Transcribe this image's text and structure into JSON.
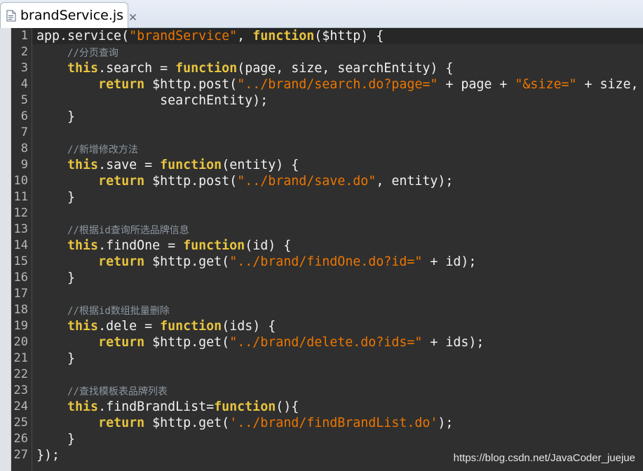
{
  "tab": {
    "title": "brandService.js",
    "icon": "js-file-icon"
  },
  "colors": {
    "background": "#2f2f2f",
    "keyword": "#e8c540",
    "string": "#ec7600",
    "comment": "#8c97a1",
    "text": "#f1f2f3",
    "line_number": "#b8b8b8"
  },
  "editor": {
    "line_numbers": [
      "1",
      "2",
      "3",
      "4",
      "5",
      "6",
      "7",
      "8",
      "9",
      "10",
      "11",
      "12",
      "13",
      "14",
      "15",
      "16",
      "17",
      "18",
      "19",
      "20",
      "21",
      "22",
      "23",
      "24",
      "25",
      "26",
      "27"
    ],
    "lines": [
      [
        {
          "t": "app.service(",
          "c": "plain"
        },
        {
          "t": "\"brandService\"",
          "c": "str"
        },
        {
          "t": ", ",
          "c": "plain"
        },
        {
          "t": "function",
          "c": "kw"
        },
        {
          "t": "($http) {",
          "c": "plain"
        }
      ],
      [
        {
          "t": "    ",
          "c": "plain"
        },
        {
          "t": "//分页查询",
          "c": "com"
        }
      ],
      [
        {
          "t": "    ",
          "c": "plain"
        },
        {
          "t": "this",
          "c": "kw"
        },
        {
          "t": ".search = ",
          "c": "plain"
        },
        {
          "t": "function",
          "c": "kw"
        },
        {
          "t": "(page, size, searchEntity) {",
          "c": "plain"
        }
      ],
      [
        {
          "t": "        ",
          "c": "plain"
        },
        {
          "t": "return",
          "c": "kw"
        },
        {
          "t": " $http.post(",
          "c": "plain"
        },
        {
          "t": "\"../brand/search.do?page=\"",
          "c": "str"
        },
        {
          "t": " + page + ",
          "c": "plain"
        },
        {
          "t": "\"&size=\"",
          "c": "str"
        },
        {
          "t": " + size,",
          "c": "plain"
        }
      ],
      [
        {
          "t": "                searchEntity);",
          "c": "plain"
        }
      ],
      [
        {
          "t": "    }",
          "c": "plain"
        }
      ],
      [],
      [
        {
          "t": "    ",
          "c": "plain"
        },
        {
          "t": "//新增修改方法",
          "c": "com"
        }
      ],
      [
        {
          "t": "    ",
          "c": "plain"
        },
        {
          "t": "this",
          "c": "kw"
        },
        {
          "t": ".save = ",
          "c": "plain"
        },
        {
          "t": "function",
          "c": "kw"
        },
        {
          "t": "(entity) {",
          "c": "plain"
        }
      ],
      [
        {
          "t": "        ",
          "c": "plain"
        },
        {
          "t": "return",
          "c": "kw"
        },
        {
          "t": " $http.post(",
          "c": "plain"
        },
        {
          "t": "\"../brand/save.do\"",
          "c": "str"
        },
        {
          "t": ", entity);",
          "c": "plain"
        }
      ],
      [
        {
          "t": "    }",
          "c": "plain"
        }
      ],
      [],
      [
        {
          "t": "    ",
          "c": "plain"
        },
        {
          "t": "//根据id查询所选品牌信息",
          "c": "com"
        }
      ],
      [
        {
          "t": "    ",
          "c": "plain"
        },
        {
          "t": "this",
          "c": "kw"
        },
        {
          "t": ".findOne = ",
          "c": "plain"
        },
        {
          "t": "function",
          "c": "kw"
        },
        {
          "t": "(id) {",
          "c": "plain"
        }
      ],
      [
        {
          "t": "        ",
          "c": "plain"
        },
        {
          "t": "return",
          "c": "kw"
        },
        {
          "t": " $http.get(",
          "c": "plain"
        },
        {
          "t": "\"../brand/findOne.do?id=\"",
          "c": "str"
        },
        {
          "t": " + id);",
          "c": "plain"
        }
      ],
      [
        {
          "t": "    }",
          "c": "plain"
        }
      ],
      [],
      [
        {
          "t": "    ",
          "c": "plain"
        },
        {
          "t": "//根据id数组批量删除",
          "c": "com"
        }
      ],
      [
        {
          "t": "    ",
          "c": "plain"
        },
        {
          "t": "this",
          "c": "kw"
        },
        {
          "t": ".dele = ",
          "c": "plain"
        },
        {
          "t": "function",
          "c": "kw"
        },
        {
          "t": "(ids) {",
          "c": "plain"
        }
      ],
      [
        {
          "t": "        ",
          "c": "plain"
        },
        {
          "t": "return",
          "c": "kw"
        },
        {
          "t": " $http.get(",
          "c": "plain"
        },
        {
          "t": "\"../brand/delete.do?ids=\"",
          "c": "str"
        },
        {
          "t": " + ids);",
          "c": "plain"
        }
      ],
      [
        {
          "t": "    }",
          "c": "plain"
        }
      ],
      [],
      [
        {
          "t": "    ",
          "c": "plain"
        },
        {
          "t": "//查找模板表品牌列表",
          "c": "com"
        }
      ],
      [
        {
          "t": "    ",
          "c": "plain"
        },
        {
          "t": "this",
          "c": "kw"
        },
        {
          "t": ".findBrandList=",
          "c": "plain"
        },
        {
          "t": "function",
          "c": "kw"
        },
        {
          "t": "(){",
          "c": "plain"
        }
      ],
      [
        {
          "t": "        ",
          "c": "plain"
        },
        {
          "t": "return",
          "c": "kw"
        },
        {
          "t": " $http.get(",
          "c": "plain"
        },
        {
          "t": "'../brand/findBrandList.do'",
          "c": "str"
        },
        {
          "t": ");",
          "c": "plain"
        }
      ],
      [
        {
          "t": "    }",
          "c": "plain"
        }
      ],
      [
        {
          "t": "});",
          "c": "plain"
        }
      ]
    ]
  },
  "watermark": "https://blog.csdn.net/JavaCoder_juejue"
}
